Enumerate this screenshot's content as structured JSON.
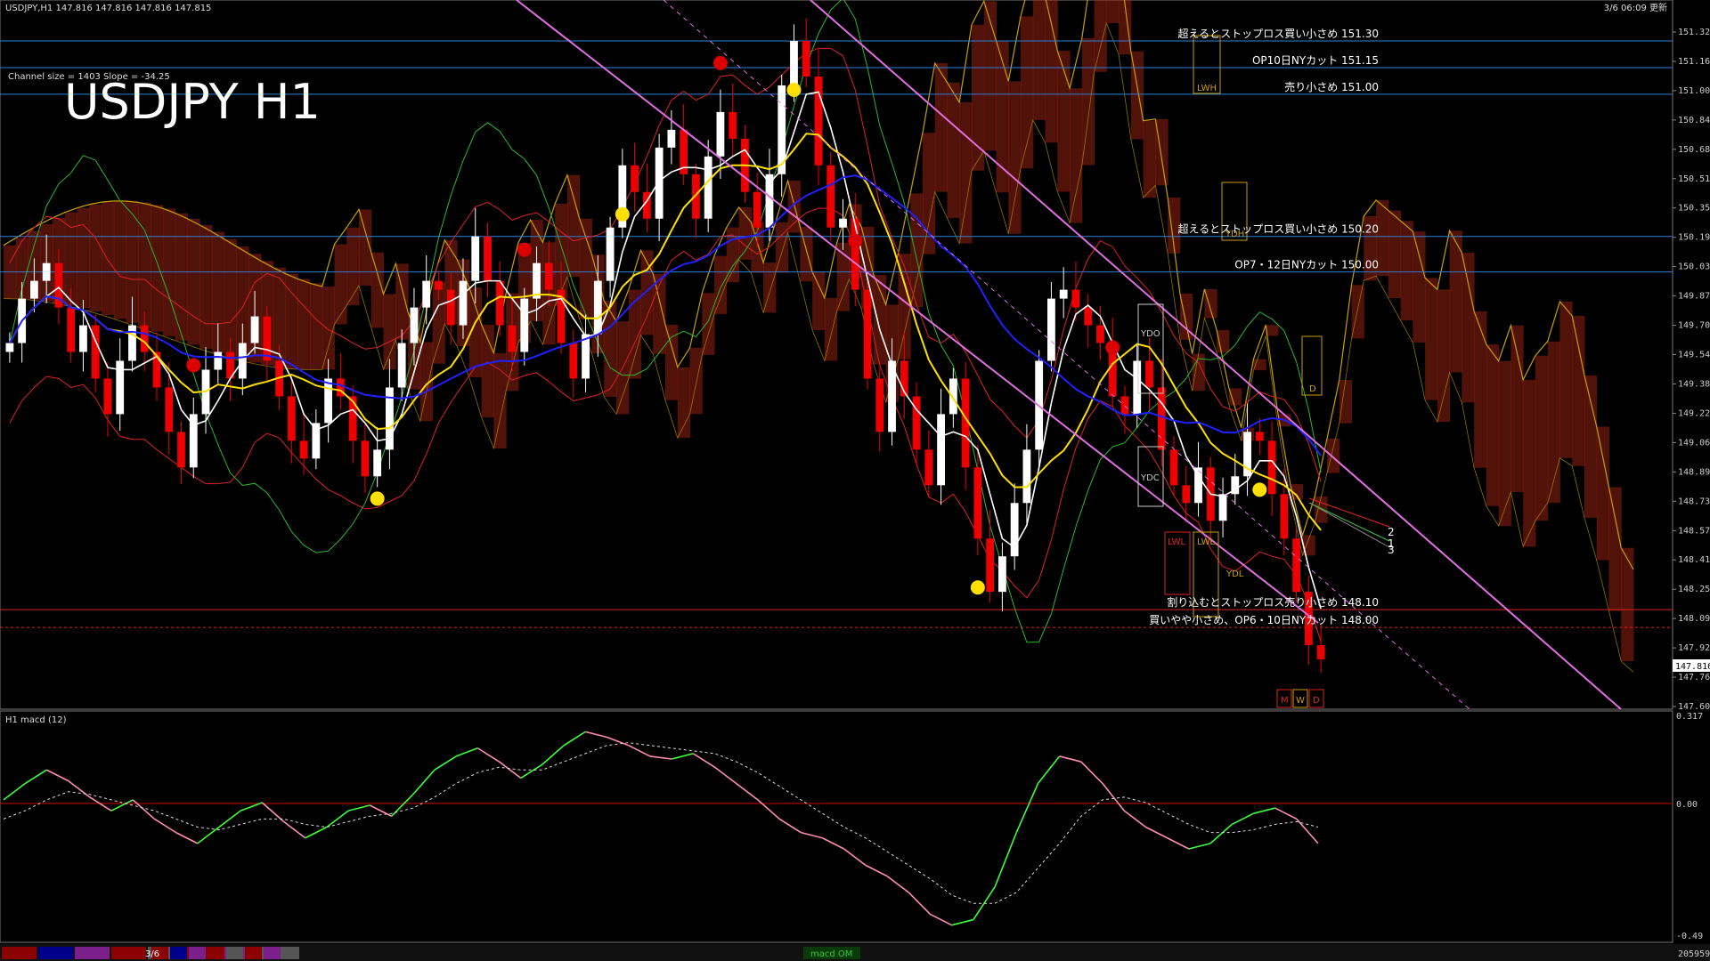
{
  "header": {
    "symbol_line": "USDJPY,H1  147.816 147.816 147.816 147.815",
    "channel_info": "Channel size = 1403 Slope = -34.25",
    "big_title": "USDJPY H1",
    "timestamp": "3/6 06:09 更新"
  },
  "annotations": [
    {
      "text": "超えるとストップロス買い小さめ 151.30",
      "price": 151.3,
      "color": "#2f7fd6"
    },
    {
      "text": "OP10日NYカット 151.15",
      "price": 151.15,
      "color": "#2f7fd6"
    },
    {
      "text": "売り小さめ 151.00",
      "price": 151.0,
      "color": "#2f7fd6"
    },
    {
      "text": "超えるとストップロス買い小さめ 150.20",
      "price": 150.2,
      "color": "#2f7fd6"
    },
    {
      "text": "OP7・12日NYカット 150.00",
      "price": 150.0,
      "color": "#2f7fd6"
    },
    {
      "text": "割り込むとストップロス売り小さめ 148.10",
      "price": 148.1,
      "color": "#d22"
    },
    {
      "text": "買いやや小さめ、OP6・10日NYカット 148.00",
      "price": 148.0,
      "color": "#d22"
    }
  ],
  "level_boxes": [
    "LWH",
    "YDH",
    "YDO",
    "YDC",
    "LWL",
    "YDL",
    "D",
    "M",
    "W",
    "D"
  ],
  "trend_labels": [
    "2",
    "1",
    "3"
  ],
  "price_axis": {
    "ticks": [
      "151.325",
      "151.160",
      "151.000",
      "150.840",
      "150.680",
      "150.515",
      "150.355",
      "150.190",
      "150.030",
      "149.870",
      "149.705",
      "149.545",
      "149.385",
      "149.220",
      "149.060",
      "148.895",
      "148.735",
      "148.575",
      "148.410",
      "148.250",
      "148.090",
      "147.925",
      "147.765",
      "147.600"
    ],
    "current_price": "147.816"
  },
  "macd_panel": {
    "title": "H1  macd (12)",
    "ticks": [
      "0.317",
      "0.00",
      "-0.49"
    ]
  },
  "status_bar": {
    "date_label": "3/6",
    "indicator_label": "macd OM",
    "right_value": "205959",
    "colors": [
      "#8b0000",
      "#00008b",
      "#7a1f8b",
      "#8b0000",
      "#555555",
      "#8b0000",
      "#7a1f8b",
      "#555555"
    ]
  },
  "chart_data": {
    "type": "candlestick",
    "symbol": "USDJPY",
    "timeframe": "H1",
    "ylim": [
      147.6,
      151.33
    ],
    "close_series": [
      149.6,
      149.85,
      149.95,
      150.05,
      149.8,
      149.55,
      149.7,
      149.4,
      149.2,
      149.5,
      149.7,
      149.55,
      149.35,
      149.1,
      148.9,
      149.2,
      149.45,
      149.55,
      149.4,
      149.6,
      149.75,
      149.5,
      149.3,
      149.05,
      148.95,
      149.15,
      149.4,
      149.3,
      149.05,
      148.85,
      149.0,
      149.35,
      149.6,
      149.8,
      149.95,
      149.9,
      149.7,
      149.95,
      150.2,
      149.95,
      149.7,
      149.55,
      149.85,
      150.05,
      149.9,
      149.6,
      149.4,
      149.65,
      149.95,
      150.25,
      150.6,
      150.45,
      150.3,
      150.7,
      150.8,
      150.55,
      150.3,
      150.65,
      150.9,
      150.75,
      150.45,
      150.25,
      150.55,
      151.05,
      151.3,
      151.1,
      150.6,
      150.25,
      150.3,
      149.9,
      149.4,
      149.1,
      149.5,
      149.3,
      149.0,
      148.8,
      149.2,
      149.4,
      148.9,
      148.5,
      148.2,
      148.4,
      148.7,
      149.0,
      149.5,
      149.85,
      149.9,
      149.8,
      149.7,
      149.6,
      149.3,
      149.2,
      149.5,
      149.35,
      149.0,
      148.8,
      148.7,
      148.9,
      148.6,
      148.75,
      148.85,
      149.1,
      149.05,
      148.75,
      148.5,
      148.2,
      147.9,
      147.82
    ],
    "macd_values": [
      0.02,
      0.08,
      0.13,
      0.09,
      0.03,
      -0.02,
      0.02,
      -0.05,
      -0.1,
      -0.14,
      -0.08,
      -0.02,
      0.01,
      -0.06,
      -0.12,
      -0.08,
      -0.02,
      0.0,
      -0.04,
      0.04,
      0.13,
      0.18,
      0.21,
      0.16,
      0.1,
      0.15,
      0.22,
      0.27,
      0.25,
      0.22,
      0.18,
      0.17,
      0.19,
      0.14,
      0.08,
      0.02,
      -0.05,
      -0.1,
      -0.12,
      -0.16,
      -0.22,
      -0.26,
      -0.32,
      -0.4,
      -0.44,
      -0.42,
      -0.3,
      -0.1,
      0.08,
      0.18,
      0.16,
      0.08,
      -0.02,
      -0.08,
      -0.12,
      -0.16,
      -0.14,
      -0.07,
      -0.03,
      -0.01,
      -0.05,
      -0.14
    ],
    "macd_signal": [
      -0.05,
      -0.02,
      0.02,
      0.05,
      0.04,
      0.02,
      0.0,
      -0.02,
      -0.05,
      -0.08,
      -0.09,
      -0.07,
      -0.05,
      -0.05,
      -0.07,
      -0.08,
      -0.06,
      -0.04,
      -0.03,
      -0.01,
      0.03,
      0.08,
      0.12,
      0.14,
      0.13,
      0.13,
      0.16,
      0.19,
      0.22,
      0.23,
      0.22,
      0.21,
      0.2,
      0.19,
      0.16,
      0.12,
      0.07,
      0.02,
      -0.03,
      -0.08,
      -0.12,
      -0.17,
      -0.22,
      -0.27,
      -0.33,
      -0.36,
      -0.36,
      -0.32,
      -0.23,
      -0.14,
      -0.04,
      0.02,
      0.03,
      0.01,
      -0.03,
      -0.07,
      -0.1,
      -0.1,
      -0.09,
      -0.07,
      -0.06,
      -0.08
    ],
    "macd_ylim": [
      -0.49,
      0.317
    ]
  }
}
